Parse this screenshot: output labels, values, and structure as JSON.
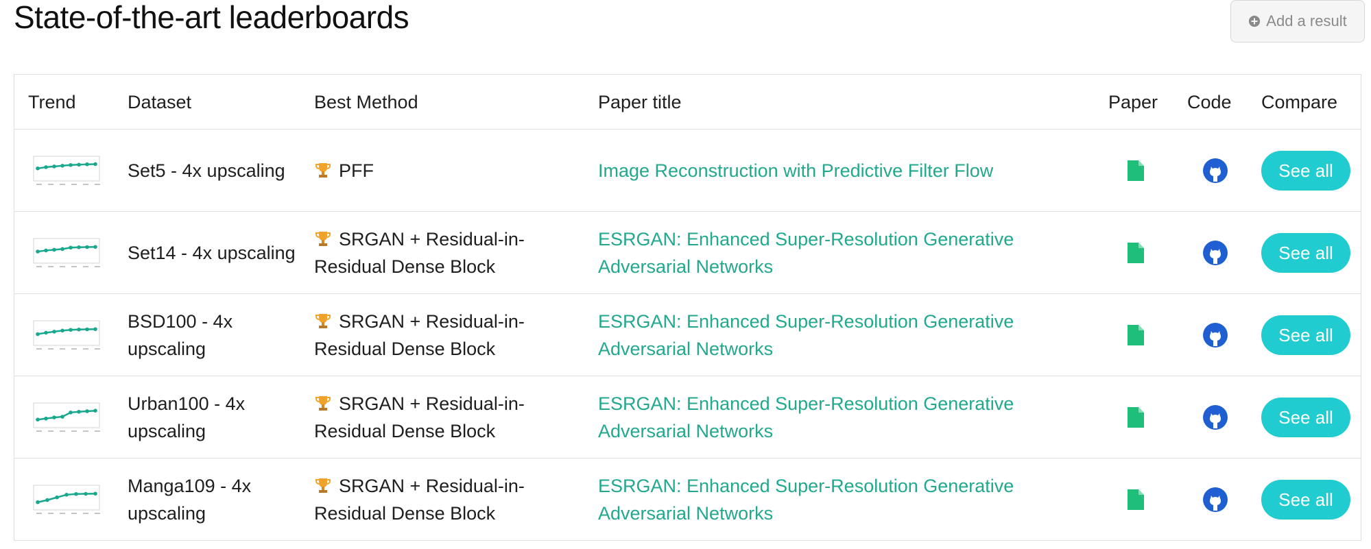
{
  "page_title": "State-of-the-art leaderboards",
  "add_result_label": "Add a result",
  "colors": {
    "accent_teal": "#22a88d",
    "button_cyan": "#21ccd0",
    "paper_green": "#1fbf79",
    "github_blue": "#1f5fd1",
    "trophy_gold": "#f2a12b"
  },
  "table": {
    "headers": {
      "trend": "Trend",
      "dataset": "Dataset",
      "method": "Best Method",
      "title": "Paper title",
      "paper": "Paper",
      "code": "Code",
      "compare": "Compare"
    },
    "rows": [
      {
        "dataset": "Set5 - 4x upscaling",
        "method": "PFF",
        "title": "Image Reconstruction with Predictive Filter Flow",
        "compare": "See all",
        "trend": [
          0.55,
          0.62,
          0.66,
          0.7,
          0.74,
          0.76,
          0.78,
          0.79
        ]
      },
      {
        "dataset": "Set14 - 4x upscaling",
        "method": "SRGAN + Residual-in-Residual Dense Block",
        "title": "ESRGAN: Enhanced Super-Resolution Generative Adversarial Networks",
        "compare": "See all",
        "trend": [
          0.5,
          0.56,
          0.6,
          0.64,
          0.72,
          0.74,
          0.75,
          0.76
        ]
      },
      {
        "dataset": "BSD100 - 4x upscaling",
        "method": "SRGAN + Residual-in-Residual Dense Block",
        "title": "ESRGAN: Enhanced Super-Resolution Generative Adversarial Networks",
        "compare": "See all",
        "trend": [
          0.48,
          0.56,
          0.62,
          0.68,
          0.72,
          0.74,
          0.75,
          0.76
        ]
      },
      {
        "dataset": "Urban100 - 4x upscaling",
        "method": "SRGAN + Residual-in-Residual Dense Block",
        "title": "ESRGAN: Enhanced Super-Resolution Generative Adversarial Networks",
        "compare": "See all",
        "trend": [
          0.3,
          0.36,
          0.42,
          0.46,
          0.7,
          0.74,
          0.77,
          0.8
        ]
      },
      {
        "dataset": "Manga109 - 4x upscaling",
        "method": "SRGAN + Residual-in-Residual Dense Block",
        "title": "ESRGAN: Enhanced Super-Resolution Generative Adversarial Networks",
        "compare": "See all",
        "trend": [
          0.28,
          0.4,
          0.55,
          0.7,
          0.74,
          0.75,
          0.76
        ]
      }
    ]
  }
}
